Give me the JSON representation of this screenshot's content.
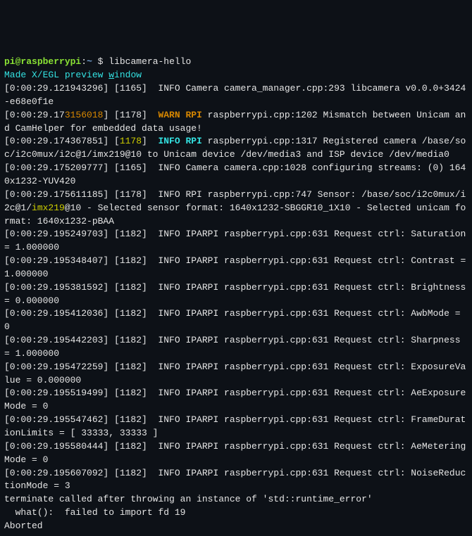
{
  "prompt": {
    "user": "pi",
    "at": "@",
    "host": "raspberrypi",
    "colon": ":",
    "path": "~",
    "dollar": " $ ",
    "command": "libcamera-hello"
  },
  "lines": {
    "l01": "Made X/EGL preview ",
    "l01w": "w",
    "l01b": "indow",
    "l02": "[0:00:29.121943296] [1165]  INFO Camera camera_manager.cpp:293 libcamera v0.0.0+3424-e68e0f1e",
    "l03a": "[0:00:29.17",
    "l03b": "3156018",
    "l03c": "] [1178]  ",
    "l03d": "WARN RPI",
    "l03e": " raspberrypi.cpp:1202 Mismatch between Unicam and CamHelper for embedded data usage!",
    "l04a": "[0:00:29.174367851] [",
    "l04b": "1178",
    "l04c": "]  ",
    "l04d": "INFO RPI",
    "l04e": " raspberrypi.cpp:1317 Registered camera /base/soc/i2c0mux/i2c@1/imx219@10 to Unicam device /dev/media3 and ISP device /dev/media0",
    "l05": "[0:00:29.175209777] [1165]  INFO Camera camera.cpp:1028 configuring streams: (0) 1640x1232-YUV420",
    "l06a": "[0:00:29.175611185] [1178]  INFO RPI raspberrypi.cpp:747 Sensor: /base/soc/i2c0mux/i2c@1/",
    "l06b": "imx219",
    "l06c": "@10 - Selected sensor format: 1640x1232-SBGGR10_1X10 - Selected unicam format: 1640x1232-pBAA",
    "l07": "[0:00:29.195249703] [1182]  INFO IPARPI raspberrypi.cpp:631 Request ctrl: Saturation = 1.000000",
    "l08": "[0:00:29.195348407] [1182]  INFO IPARPI raspberrypi.cpp:631 Request ctrl: Contrast = 1.000000",
    "l09": "[0:00:29.195381592] [1182]  INFO IPARPI raspberrypi.cpp:631 Request ctrl: Brightness = 0.000000",
    "l10": "[0:00:29.195412036] [1182]  INFO IPARPI raspberrypi.cpp:631 Request ctrl: AwbMode = 0",
    "l11": "[0:00:29.195442203] [1182]  INFO IPARPI raspberrypi.cpp:631 Request ctrl: Sharpness = 1.000000",
    "l12": "[0:00:29.195472259] [1182]  INFO IPARPI raspberrypi.cpp:631 Request ctrl: ExposureValue = 0.000000",
    "l13": "[0:00:29.195519499] [1182]  INFO IPARPI raspberrypi.cpp:631 Request ctrl: AeExposureMode = 0",
    "l14": "[0:00:29.195547462] [1182]  INFO IPARPI raspberrypi.cpp:631 Request ctrl: FrameDurationLimits = [ 33333, 33333 ]",
    "l15": "[0:00:29.195580444] [1182]  INFO IPARPI raspberrypi.cpp:631 Request ctrl: AeMeteringMode = 0",
    "l16": "[0:00:29.195607092] [1182]  INFO IPARPI raspberrypi.cpp:631 Request ctrl: NoiseReductionMode = 3",
    "l17": "terminate called after throwing an instance of 'std::runtime_error'",
    "l18": "  what():  failed to import fd 19",
    "l19": "Aborted"
  }
}
